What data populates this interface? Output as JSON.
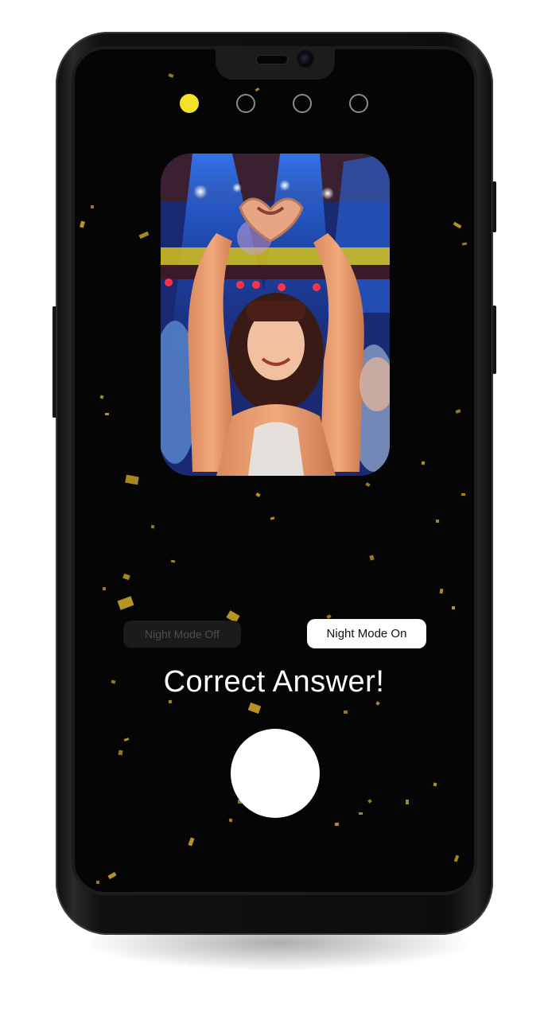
{
  "app": {
    "pagination": {
      "total": 4,
      "active_index": 0
    },
    "photo": {
      "subject": "woman making heart shape with hands at a concert"
    },
    "toggles": {
      "off_label": "Night Mode Off",
      "on_label": "Night Mode On",
      "selected": "on"
    },
    "result": {
      "headline": "Correct Answer!"
    },
    "colors": {
      "accent": "#f4e22a",
      "confetti": "#c9a227",
      "screen_bg": "#050505",
      "text": "#ffffff"
    }
  }
}
